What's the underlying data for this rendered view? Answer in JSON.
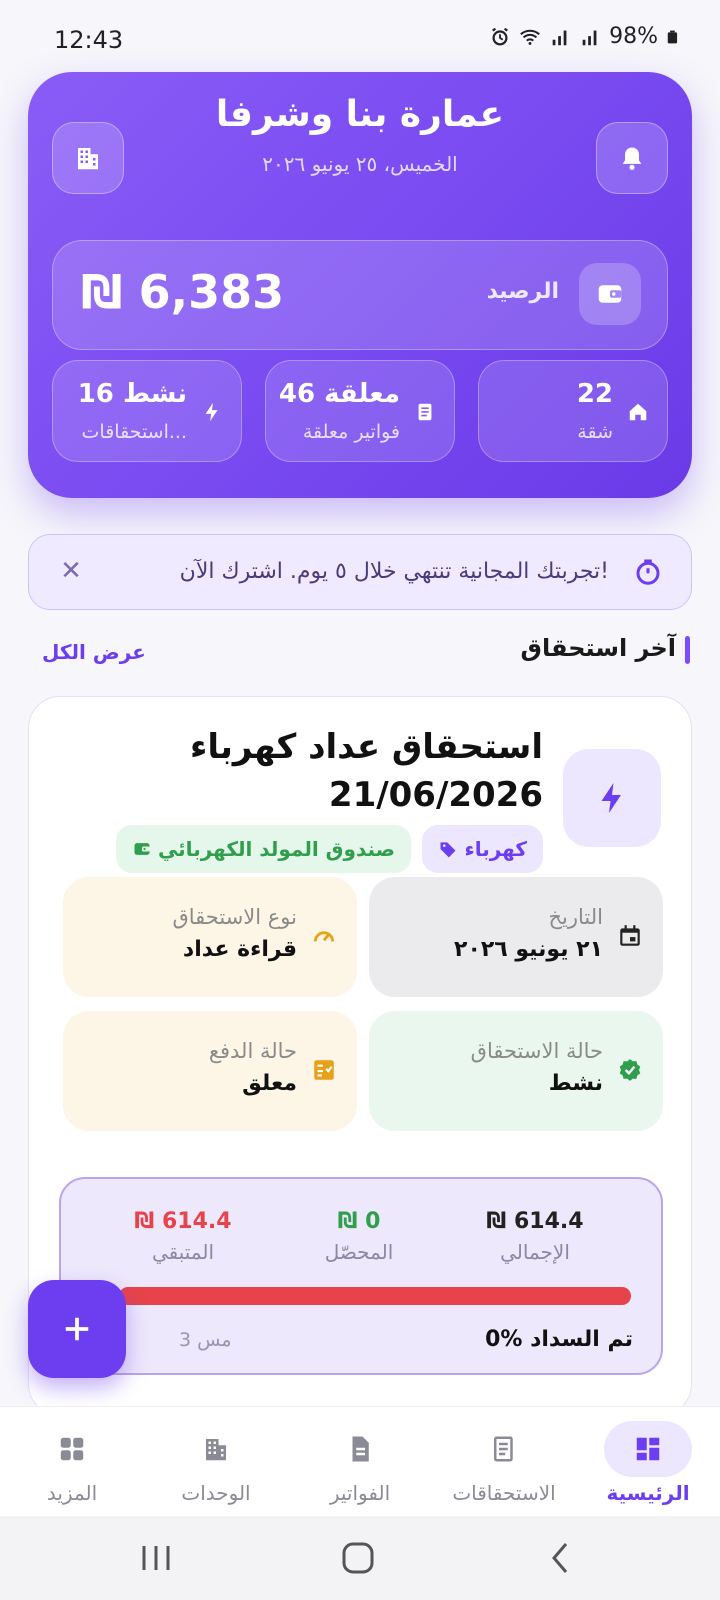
{
  "status": {
    "time": "12:43",
    "battery": "98%"
  },
  "header": {
    "title": "عمارة بنا وشرفا",
    "date": "الخميس، ٢٥ يونيو ٢٠٢٦",
    "balance_label": "الرصيد",
    "balance_amount": "₪ 6,383"
  },
  "stats": [
    {
      "value": "22",
      "label": "شقة",
      "icon": "home-icon"
    },
    {
      "value": "46 معلقة",
      "label": "فواتير معلقة",
      "icon": "receipt-icon"
    },
    {
      "value": "16 نشط",
      "label": "استحقاقات...",
      "icon": "bolt-icon"
    }
  ],
  "trial": {
    "text": "تجربتك المجانية تنتهي خلال ٥ يوم. اشترك الآن!"
  },
  "section": {
    "title": "آخر استحقاق",
    "view_all": "عرض الكل"
  },
  "card": {
    "title_line1": "استحقاق عداد كهرباء",
    "title_line2": "21/06/2026",
    "tags": [
      "كهرباء",
      "صندوق المولد الكهربائي"
    ],
    "date_label": "التاريخ",
    "date_value": "٢١ يونيو ٢٠٢٦",
    "type_label": "نوع الاستحقاق",
    "type_value": "قراءة عداد",
    "status_label": "حالة الاستحقاق",
    "status_value": "نشط",
    "payment_label": "حالة الدفع",
    "payment_value": "معلق",
    "total_value": "₪ 614.4",
    "total_label": "الإجمالي",
    "collected_value": "₪ 0",
    "collected_label": "المحصّل",
    "remaining_value": "₪ 614.4",
    "remaining_label": "المتبقي",
    "paid_percent_text": "0% تم السداد",
    "paid_fraction": 0,
    "remaining_count_text": "3 مس"
  },
  "nav": [
    "الرئيسية",
    "الاستحقاقات",
    "الفواتير",
    "الوحدات",
    "المزيد"
  ],
  "colors": {
    "accent": "#6c3ef0",
    "danger": "#e7434a",
    "success": "#2f9e4d",
    "warning": "#e8a21a"
  }
}
